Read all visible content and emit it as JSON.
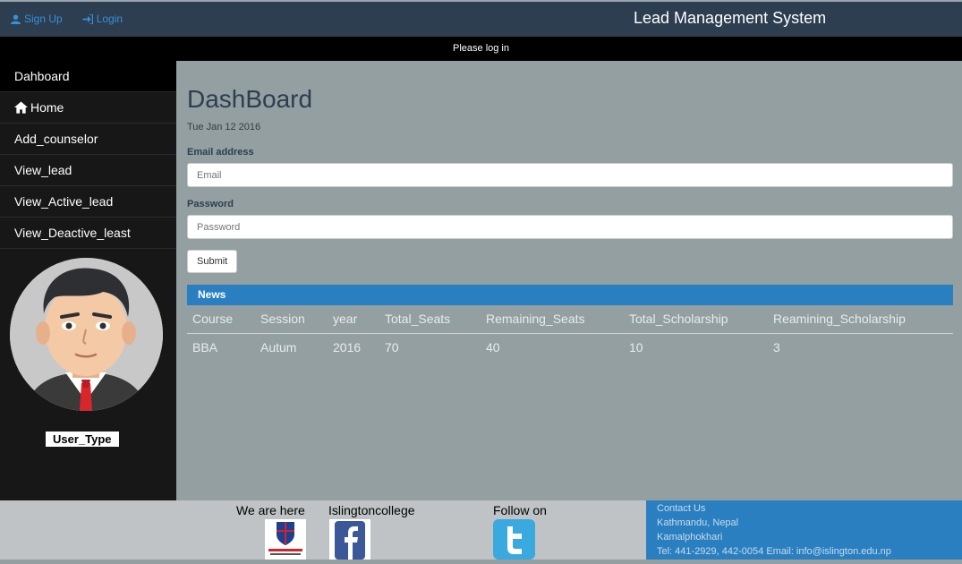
{
  "topbar": {
    "signup": "Sign Up",
    "login": "Login",
    "brand": "Lead Management System"
  },
  "notice": "Please log in",
  "sidebar": {
    "items": [
      {
        "label": "Dahboard"
      },
      {
        "label": "Home"
      },
      {
        "label": "Add_counselor"
      },
      {
        "label": "View_lead"
      },
      {
        "label": "View_Active_lead"
      },
      {
        "label": "View_Deactive_least"
      }
    ],
    "user_type": "User_Type"
  },
  "main": {
    "title": "DashBoard",
    "date": "Tue Jan 12 2016",
    "email_label": "Email address",
    "email_placeholder": "Email",
    "password_label": "Password",
    "password_placeholder": "Password",
    "submit": "Submit",
    "news": "News",
    "table": {
      "headers": [
        "Course",
        "Session",
        "year",
        "Total_Seats",
        "Remaining_Seats",
        "Total_Scholarship",
        "Reamining_Scholarship"
      ],
      "rows": [
        [
          "BBA",
          "Autum",
          "2016",
          "70",
          "40",
          "10",
          "3"
        ]
      ]
    }
  },
  "footer": {
    "we_are_here": "We are here",
    "college": "Islingtoncollege",
    "follow": "Follow on",
    "contact": {
      "title": "Contact Us",
      "line1": "Kathmandu, Nepal",
      "line2": "Kamalphokhari",
      "line3": "Tel: 441-2929, 442-0054 Email: info@islington.edu.np"
    }
  }
}
